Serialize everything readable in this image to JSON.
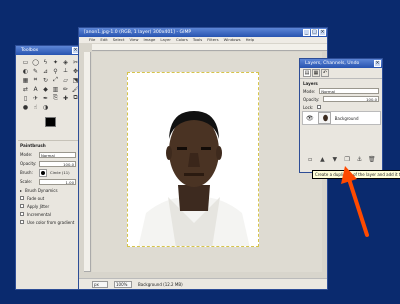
{
  "toolbox": {
    "title": "Toolbox",
    "tools": [
      "rect-select",
      "ellipse-select",
      "free-select",
      "fuzzy-select",
      "color-select",
      "scissors",
      "foreground-select",
      "paths",
      "color-picker",
      "zoom",
      "measure",
      "move",
      "align",
      "crop",
      "rotate",
      "scale",
      "shear",
      "perspective",
      "flip",
      "text",
      "bucket-fill",
      "blend",
      "pencil",
      "paintbrush",
      "eraser",
      "airbrush",
      "ink",
      "clone",
      "heal",
      "perspective-clone",
      "blur",
      "smudge",
      "dodge-burn"
    ],
    "options": {
      "heading": "Paintbrush",
      "mode_label": "Mode:",
      "mode_value": "Normal",
      "opacity_label": "Opacity:",
      "opacity_value": "100.0",
      "brush_label": "Brush:",
      "brush_value": "Circle (11)",
      "scale_label": "Scale:",
      "scale_value": "1.00",
      "brush_dynamics": "Brush Dynamics",
      "checks": [
        "Fade out",
        "Apply Jitter",
        "Incremental",
        "Use color from gradient"
      ]
    }
  },
  "image_window": {
    "title": "[anon1.jpg-1.0 (RGB, 1 layer) 300x401] - GIMP",
    "menus": [
      "File",
      "Edit",
      "Select",
      "View",
      "Image",
      "Layer",
      "Colors",
      "Tools",
      "Filters",
      "Windows",
      "Help"
    ],
    "status": {
      "unit": "px",
      "zoom": "100%",
      "info": "Background (12.2 MB)"
    }
  },
  "layers": {
    "title": "Layers, Channels, Undo",
    "section": "Layers",
    "mode_label": "Mode:",
    "mode_value": "Normal",
    "opacity_label": "Opacity:",
    "opacity_value": "100.0",
    "lock_label": "Lock:",
    "layer_name": "Background"
  },
  "tooltip": "Create a duplicate of the layer and add it to the image"
}
